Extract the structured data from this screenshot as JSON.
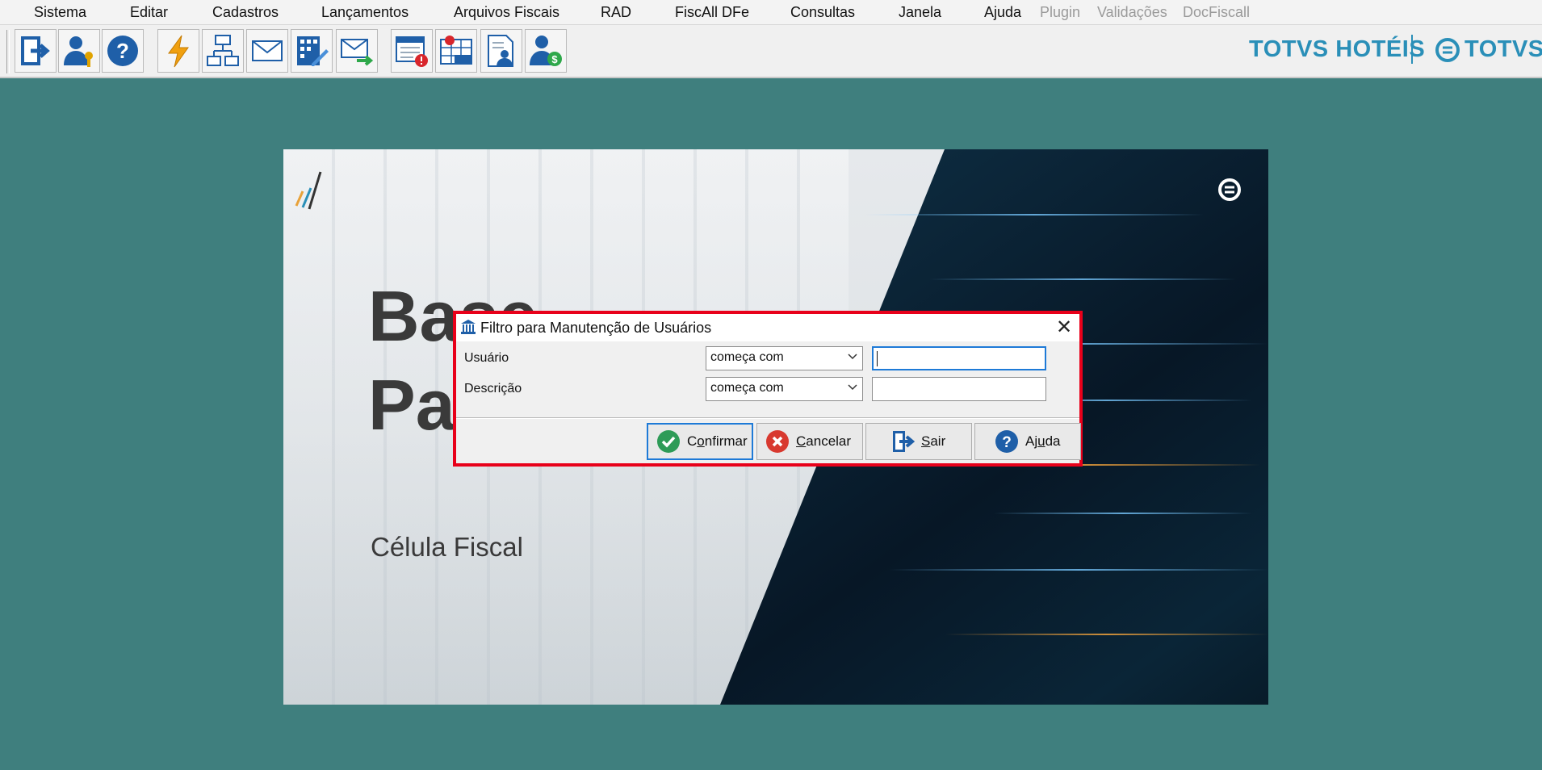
{
  "menu": {
    "items": [
      "Sistema",
      "Editar",
      "Cadastros",
      "Lançamentos",
      "Arquivos Fiscais",
      "RAD",
      "FiscAll DFe",
      "Consultas",
      "Janela",
      "Ajuda"
    ],
    "disabled_items": [
      "Plugin",
      "Validações",
      "DocFiscall"
    ]
  },
  "toolbar": {
    "icons": [
      "exit-icon",
      "user-key-icon",
      "help-icon",
      "lightning-icon",
      "org-chart-icon",
      "envelope-icon",
      "calculator-pen-icon",
      "send-mail-icon",
      "calendar-alert-icon",
      "icms-table-icon",
      "user-document-icon",
      "user-money-icon"
    ],
    "brand_left": "TOTVS HOTÉIS",
    "brand_right": "TOTVS"
  },
  "splash": {
    "title_line1": "Base",
    "title_line2": "Pa",
    "subtitle": "Célula Fiscal"
  },
  "dialog": {
    "title": "Filtro para Manutenção de Usuários",
    "fields": [
      {
        "label": "Usuário",
        "operator": "começa com",
        "value": ""
      },
      {
        "label": "Descrição",
        "operator": "começa com",
        "value": ""
      }
    ],
    "buttons": {
      "confirm": {
        "pre": "C",
        "hot": "o",
        "post": "nfirmar"
      },
      "cancel": {
        "pre": "",
        "hot": "C",
        "post": "ancelar"
      },
      "exit": {
        "pre": "",
        "hot": "S",
        "post": "air"
      },
      "help": {
        "pre": "Aj",
        "hot": "u",
        "post": "da"
      }
    }
  },
  "colors": {
    "desktop": "#3f7f7e",
    "brand": "#2a8fb8",
    "highlight_border": "#e8001a",
    "focus": "#1e7ad7"
  }
}
